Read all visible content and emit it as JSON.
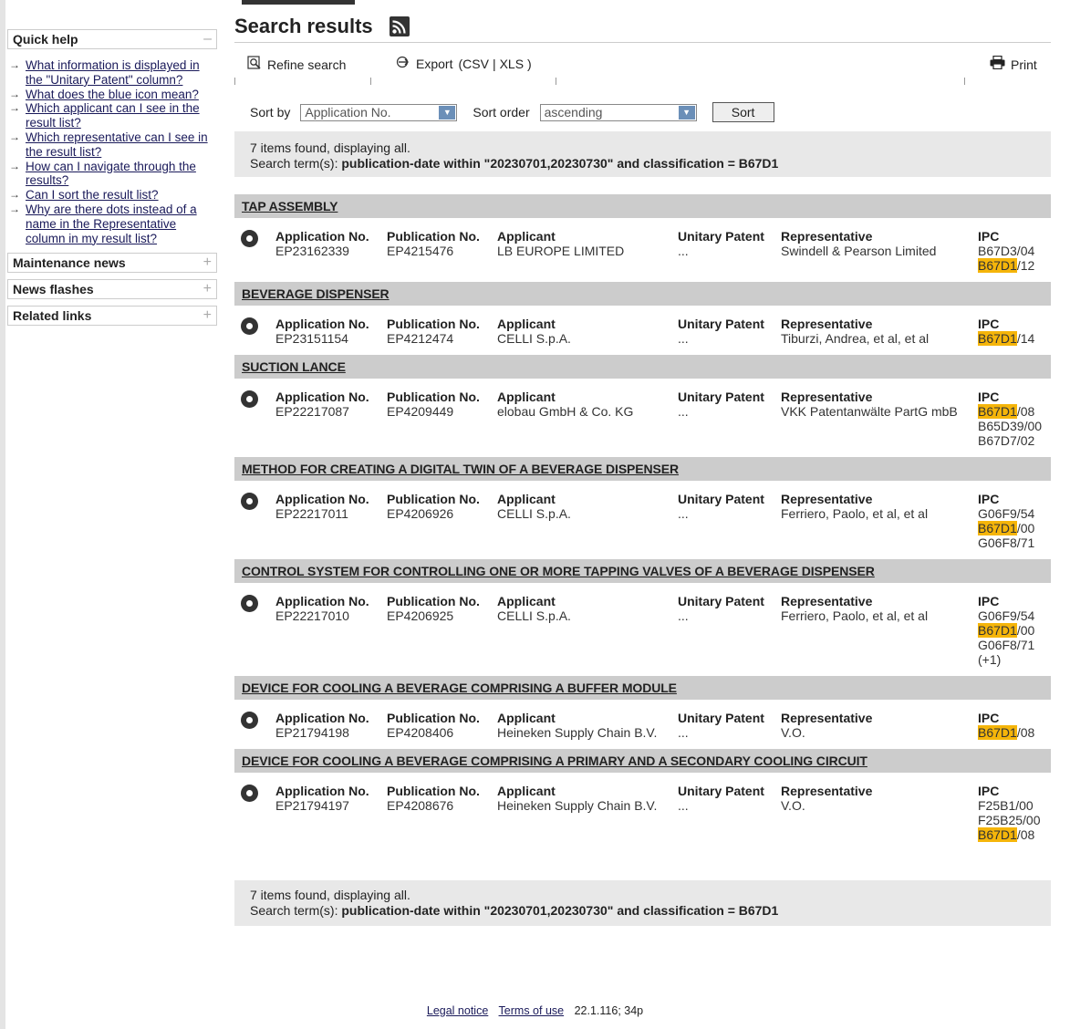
{
  "sidebar": {
    "quick_help": {
      "title": "Quick help",
      "toggle": "–",
      "items": [
        {
          "label": "What information is displayed in the \"Unitary Patent\" column?"
        },
        {
          "label": "What does the blue icon mean?"
        },
        {
          "label": "Which applicant can I see in the result list?"
        },
        {
          "label": "Which representative can I see in the result list?"
        },
        {
          "label": "How can I navigate through the results?"
        },
        {
          "label": "Can I sort the result list?"
        },
        {
          "label": "Why are there dots instead of a name in the Representative column in my result list?"
        }
      ]
    },
    "maintenance": {
      "title": "Maintenance news",
      "toggle": "+"
    },
    "news": {
      "title": "News flashes",
      "toggle": "+"
    },
    "related": {
      "title": "Related links",
      "toggle": "+"
    }
  },
  "main": {
    "title": "Search results",
    "toolbar": {
      "refine": "Refine search",
      "export_label": "Export",
      "export_csv": "CSV",
      "export_sep": "|",
      "export_xls": "XLS",
      "print": "Print"
    },
    "sort": {
      "sort_by_label": "Sort by",
      "sort_by_value": "Application No.",
      "sort_order_label": "Sort order",
      "sort_order_value": "ascending",
      "sort_button": "Sort"
    },
    "summary": {
      "count_text": "7 items found, displaying all.",
      "terms_label": "Search term(s):",
      "terms_value": "publication-date within \"20230701,20230730\" and classification = B67D1"
    },
    "headers": {
      "app": "Application No.",
      "pub": "Publication No.",
      "applicant": "Applicant",
      "unitary": "Unitary Patent",
      "rep": "Representative",
      "ipc": "IPC"
    },
    "results": [
      {
        "title": "TAP ASSEMBLY",
        "app": "EP23162339",
        "pub": "EP4215476",
        "applicant": "LB EUROPE LIMITED",
        "unitary": "...",
        "rep": "Swindell & Pearson Limited",
        "ipc": [
          {
            "pre": "B67D3/04",
            "hl": "",
            "post": ""
          },
          {
            "pre": "",
            "hl": "B67D1",
            "post": "/12"
          }
        ]
      },
      {
        "title": "BEVERAGE DISPENSER",
        "app": "EP23151154",
        "pub": "EP4212474",
        "applicant": "CELLI S.p.A.",
        "unitary": "...",
        "rep": "Tiburzi, Andrea, et al, et al",
        "ipc": [
          {
            "pre": "",
            "hl": "B67D1",
            "post": "/14"
          }
        ]
      },
      {
        "title": "SUCTION LANCE",
        "app": "EP22217087",
        "pub": "EP4209449",
        "applicant": "elobau GmbH & Co. KG",
        "unitary": "...",
        "rep": "VKK Patentanwälte PartG mbB",
        "ipc": [
          {
            "pre": "",
            "hl": "B67D1",
            "post": "/08"
          },
          {
            "pre": "B65D39/00",
            "hl": "",
            "post": ""
          },
          {
            "pre": "B67D7/02",
            "hl": "",
            "post": ""
          }
        ]
      },
      {
        "title": "METHOD FOR CREATING A DIGITAL TWIN OF A BEVERAGE DISPENSER",
        "app": "EP22217011",
        "pub": "EP4206926",
        "applicant": "CELLI S.p.A.",
        "unitary": "...",
        "rep": "Ferriero, Paolo, et al, et al",
        "ipc": [
          {
            "pre": "G06F9/54",
            "hl": "",
            "post": ""
          },
          {
            "pre": "",
            "hl": "B67D1",
            "post": "/00"
          },
          {
            "pre": "G06F8/71",
            "hl": "",
            "post": ""
          }
        ]
      },
      {
        "title": "CONTROL SYSTEM FOR CONTROLLING ONE OR MORE TAPPING VALVES OF A BEVERAGE DISPENSER",
        "app": "EP22217010",
        "pub": "EP4206925",
        "applicant": "CELLI S.p.A.",
        "unitary": "...",
        "rep": "Ferriero, Paolo, et al, et al",
        "ipc": [
          {
            "pre": "G06F9/54",
            "hl": "",
            "post": ""
          },
          {
            "pre": "",
            "hl": "B67D1",
            "post": "/00"
          },
          {
            "pre": "G06F8/71",
            "hl": "",
            "post": ""
          },
          {
            "pre": "(+1)",
            "hl": "",
            "post": ""
          }
        ]
      },
      {
        "title": "DEVICE FOR COOLING A BEVERAGE COMPRISING A BUFFER MODULE",
        "app": "EP21794198",
        "pub": "EP4208406",
        "applicant": "Heineken Supply Chain B.V.",
        "unitary": "...",
        "rep": "V.O.",
        "ipc": [
          {
            "pre": "",
            "hl": "B67D1",
            "post": "/08"
          }
        ]
      },
      {
        "title": "DEVICE FOR COOLING A BEVERAGE COMPRISING A PRIMARY AND A SECONDARY COOLING CIRCUIT",
        "app": "EP21794197",
        "pub": "EP4208676",
        "applicant": "Heineken Supply Chain B.V.",
        "unitary": "...",
        "rep": "V.O.",
        "ipc": [
          {
            "pre": "F25B1/00",
            "hl": "",
            "post": ""
          },
          {
            "pre": "F25B25/00",
            "hl": "",
            "post": ""
          },
          {
            "pre": "",
            "hl": "B67D1",
            "post": "/08"
          }
        ]
      }
    ]
  },
  "footer": {
    "legal": "Legal notice",
    "terms": "Terms of use",
    "version": "22.1.116; 34p"
  }
}
